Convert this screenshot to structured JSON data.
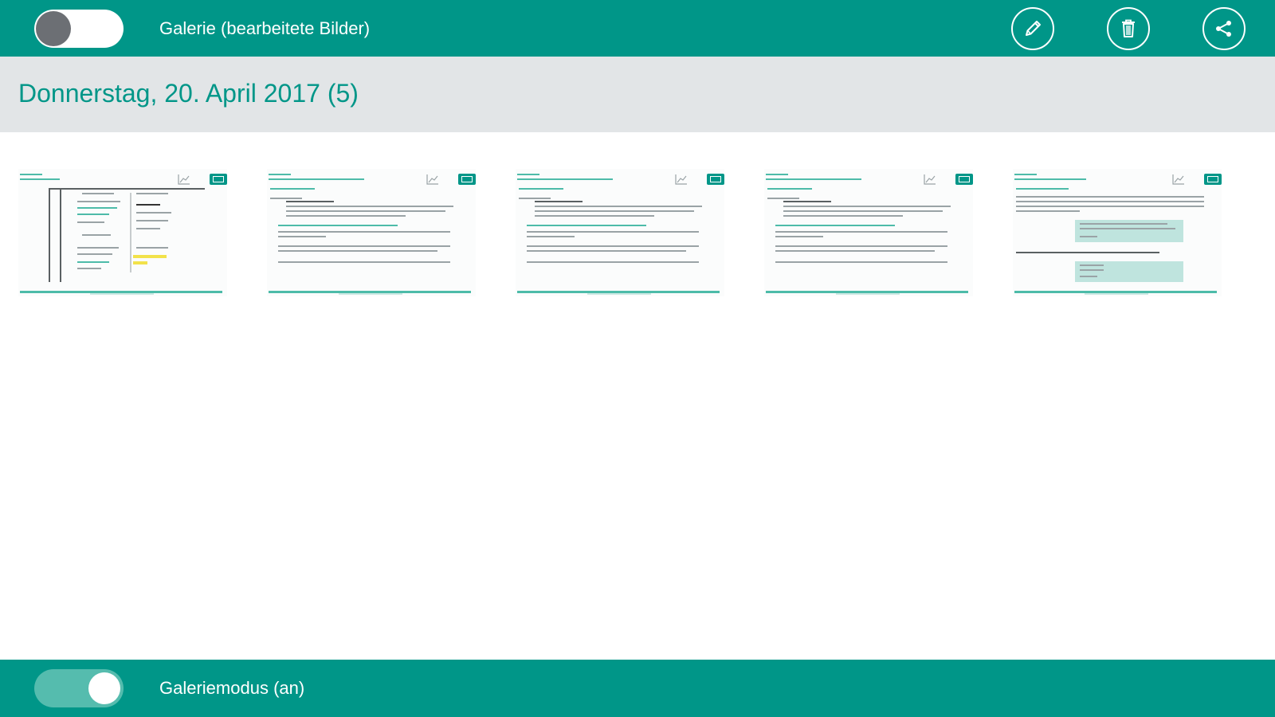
{
  "header": {
    "title": "Galerie (bearbeitete Bilder)",
    "toggle_state": "off",
    "actions": [
      {
        "name": "edit",
        "icon": "pencil-icon"
      },
      {
        "name": "delete",
        "icon": "trash-icon"
      },
      {
        "name": "share",
        "icon": "share-icon"
      }
    ]
  },
  "section": {
    "date_title": "Donnerstag, 20. April 2017 (5)"
  },
  "gallery": {
    "image_count": 5
  },
  "footer": {
    "label": "Galeriemodus (an)",
    "toggle_state": "on"
  },
  "colors": {
    "primary": "#009688",
    "header_bg": "#e2e5e7",
    "accent_light": "#55bcae"
  }
}
